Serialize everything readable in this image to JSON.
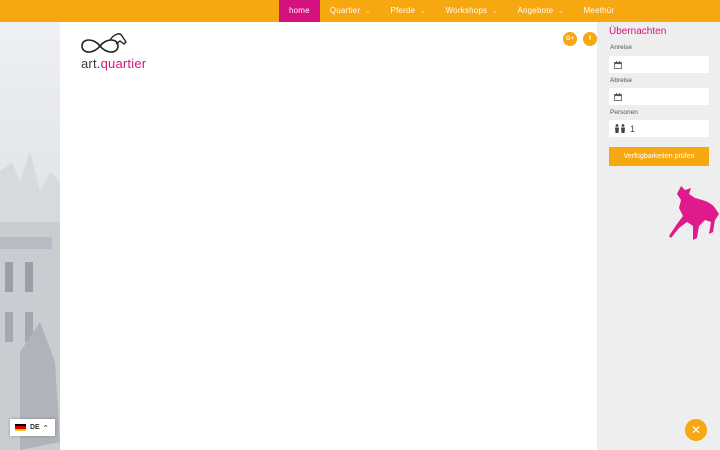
{
  "nav": {
    "items": [
      {
        "label": "home",
        "active": true,
        "has_dropdown": false
      },
      {
        "label": "Quartier",
        "active": false,
        "has_dropdown": true
      },
      {
        "label": "Pferde",
        "active": false,
        "has_dropdown": true
      },
      {
        "label": "Workshops",
        "active": false,
        "has_dropdown": true
      },
      {
        "label": "Angebote",
        "active": false,
        "has_dropdown": true
      },
      {
        "label": "Meethür",
        "active": false,
        "has_dropdown": false
      }
    ]
  },
  "logo": {
    "prefix": "art",
    "dot": ".",
    "suffix": "quartier"
  },
  "social": {
    "google_plus": "G+",
    "facebook": "f"
  },
  "booking": {
    "title": "Übernachten",
    "arrival_label": "Anreise",
    "arrival_value": "",
    "departure_label": "Abreise",
    "departure_value": "",
    "persons_label": "Personen",
    "persons_value": "1",
    "submit_label": "Verfügbarkeiten prüfen"
  },
  "language": {
    "code": "DE"
  },
  "colors": {
    "accent": "#f7a70f",
    "brand": "#d4117f",
    "sidebar_bg": "#eeeeee"
  },
  "icons": {
    "calendar": "calendar-icon",
    "persons": "persons-icon",
    "close": "close-icon",
    "flag": "german-flag-icon"
  }
}
